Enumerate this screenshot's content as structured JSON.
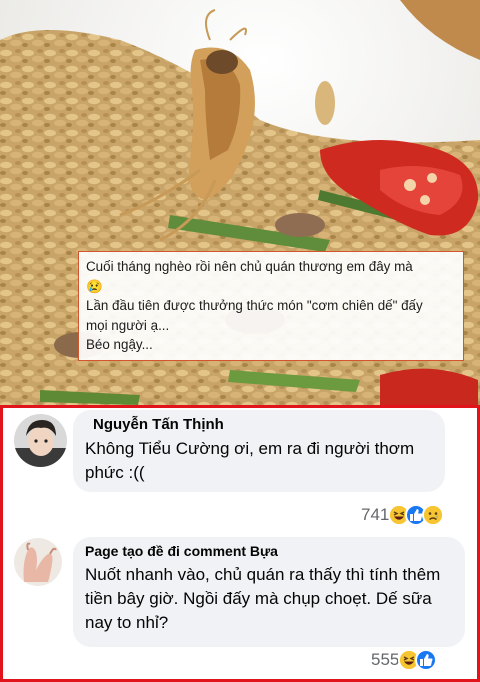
{
  "post": {
    "caption_lines": [
      "Cuối tháng nghèo rồi nên chủ quán thương em đây mà",
      "😢",
      "Lần đầu tiên được thưởng thức món \"cơm chiên dế\" đấy",
      "mọi người ạ...",
      "Béo ngậy..."
    ]
  },
  "comments": [
    {
      "author": "Nguyễn Tấn Thịnh",
      "text": "Không Tiểu Cường ơi, em ra đi người thơm phức :((",
      "reaction_count": "741",
      "reactions": [
        "haha-icon",
        "like-icon",
        "sad-icon"
      ]
    },
    {
      "author": "Page tạo đề đi comment Bựa",
      "text": "Nuốt nhanh vào, chủ quán ra thấy thì tính thêm tiền bây giờ. Ngồi đấy mà chụp choẹt. Dế sữa nay to nhỉ?",
      "reaction_count": "555",
      "reactions": [
        "haha-icon",
        "like-icon"
      ]
    }
  ],
  "colors": {
    "frame": "#e0141a",
    "caption_border": "#d3552d",
    "bubble": "#f0f2f5",
    "like": "#1877f2",
    "emoji_yellow": "#f7c531"
  }
}
